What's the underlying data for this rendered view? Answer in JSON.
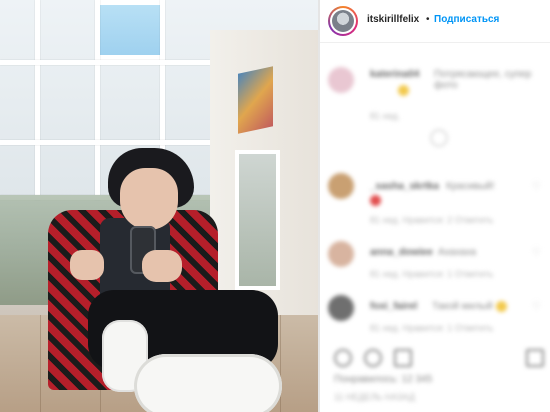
{
  "post": {
    "image_description": "",
    "icon": "photo"
  },
  "header": {
    "username": "itskirillfelix",
    "separator": "•",
    "follow_label": "Подписаться",
    "follow_color": "#0095f6",
    "avatar_icon": "avatar-icon"
  },
  "comments": [
    {
      "name": "katerina04",
      "text": "Потрясающее, супер фото",
      "meta": "81 нед.",
      "avatar_color": "#e9c7d2",
      "emoji": true
    },
    {
      "name": "",
      "text": "",
      "meta": "",
      "avatar_color": "#eeeeee",
      "emoji": false
    },
    {
      "name": "_sasha_skrtka",
      "text": "Красивый!",
      "meta": "81 нед.   Нравится: 2   Ответить",
      "avatar_color": "#c9a072",
      "emoji": true,
      "emoji_red": true
    },
    {
      "name": "anna_dowiee",
      "text": "Ахахаха",
      "meta": "81 нед.   Нравится: 1   Ответить",
      "avatar_color": "#d8b4a0",
      "emoji": false
    },
    {
      "name": "foxi_fairel",
      "text": "Такой милый",
      "meta": "81 нед.   Нравится: 1   Ответить",
      "avatar_color": "#6f6f6f",
      "emoji": true
    }
  ],
  "actions": {
    "like_icon": "heart-icon",
    "comment_icon": "comment-icon",
    "share_icon": "share-icon",
    "save_icon": "bookmark-icon"
  },
  "stats": {
    "likes_text": "Понравилось: 12 345",
    "posted_text": "11 НЕДЕЛЬ НАЗАД"
  }
}
